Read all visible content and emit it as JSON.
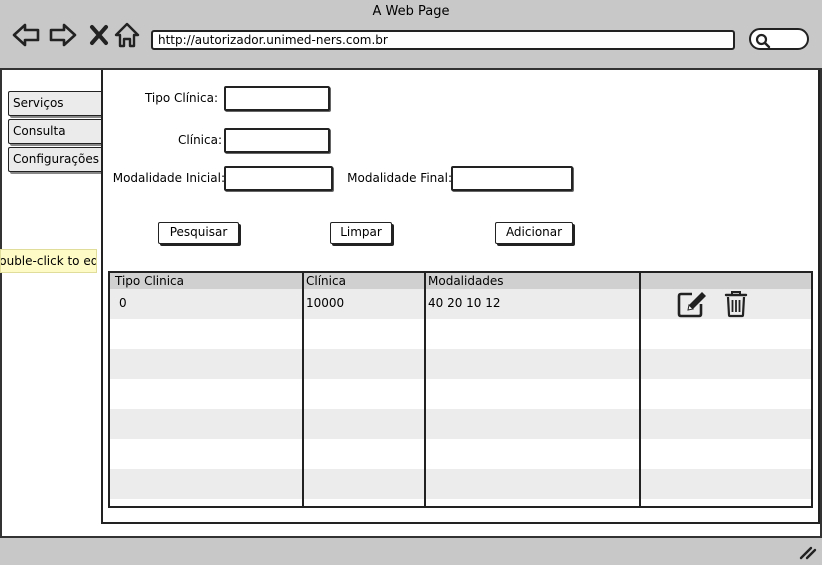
{
  "window": {
    "title": "A Web Page"
  },
  "browser": {
    "url": "http://autorizador.unimed-ners.com.br",
    "icons": [
      "back-arrow-icon",
      "forward-arrow-icon",
      "close-x-icon",
      "home-icon",
      "search-icon"
    ]
  },
  "sidebar": {
    "items": [
      {
        "label": "Serviços"
      },
      {
        "label": "Consulta"
      },
      {
        "label": "Configurações"
      }
    ]
  },
  "tooltip": {
    "text": "Double-click to edit"
  },
  "form": {
    "tipo_clinica_label": "Tipo Clínica:",
    "tipo_clinica_value": "",
    "clinica_label": "Clínica:",
    "clinica_value": "",
    "modalidade_inicial_label": "Modalidade Inicial:",
    "modalidade_inicial_value": "",
    "modalidade_final_label": "Modalidade Final:",
    "modalidade_final_value": ""
  },
  "actions": {
    "search_label": "Pesquisar",
    "clear_label": "Limpar",
    "add_label": "Adicionar"
  },
  "table": {
    "columns": [
      "Tipo Clinica",
      "Clínica",
      "Modalidades",
      ""
    ],
    "rows": [
      {
        "tipo_clinica": "0",
        "clinica": "10000",
        "modalidades": "40 20 10 12",
        "row_icons": [
          "edit-icon",
          "trash-icon"
        ]
      }
    ]
  },
  "colors": {
    "chrome_gray": "#c8c8c8",
    "row_stripe": "#ececec",
    "header_gray": "#d0d0d0",
    "tooltip_yellow": "#fffbc6",
    "stroke": "#222222"
  }
}
